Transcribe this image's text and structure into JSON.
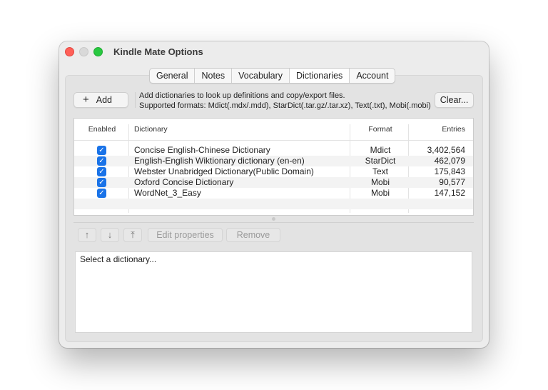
{
  "window": {
    "title": "Kindle Mate Options"
  },
  "tabs": [
    "General",
    "Notes",
    "Vocabulary",
    "Dictionaries",
    "Account"
  ],
  "active_tab": "Dictionaries",
  "toolbar": {
    "add_label": "Add",
    "info_line1": "Add dictionaries to look up definitions and copy/export files.",
    "info_line2": "Supported formats: Mdict(.mdx/.mdd), StarDict(.tar.gz/.tar.xz), Text(.txt), Mobi(.mobi)",
    "clear_label": "Clear..."
  },
  "table": {
    "headers": {
      "enabled": "Enabled",
      "dictionary": "Dictionary",
      "format": "Format",
      "entries": "Entries"
    },
    "rows": [
      {
        "enabled": true,
        "name": "Concise English-Chinese Dictionary",
        "format": "Mdict",
        "entries": "3,402,564"
      },
      {
        "enabled": true,
        "name": "English-English Wiktionary dictionary (en-en)",
        "format": "StarDict",
        "entries": "462,079"
      },
      {
        "enabled": true,
        "name": "Webster Unabridged Dictionary(Public Domain)",
        "format": "Text",
        "entries": "175,843"
      },
      {
        "enabled": true,
        "name": "Oxford Concise Dictionary",
        "format": "Mobi",
        "entries": "90,577"
      },
      {
        "enabled": true,
        "name": "WordNet_3_Easy",
        "format": "Mobi",
        "entries": "147,152"
      }
    ]
  },
  "actions": {
    "edit_label": "Edit properties",
    "remove_label": "Remove"
  },
  "detail": {
    "placeholder_text": "Select a dictionary..."
  }
}
